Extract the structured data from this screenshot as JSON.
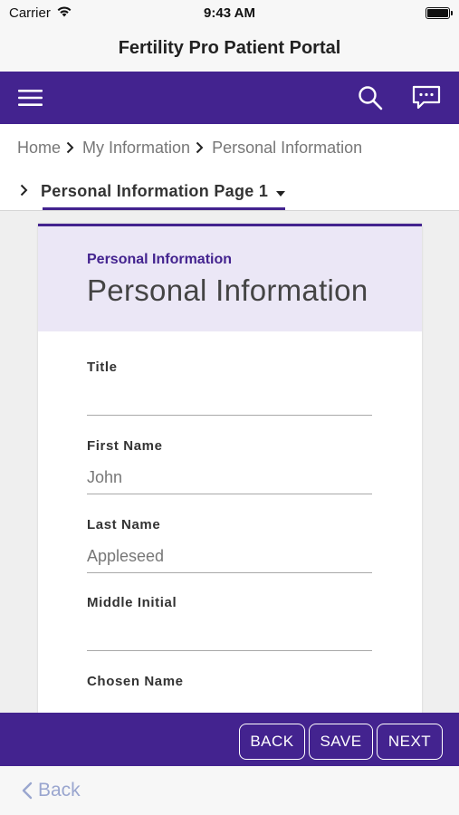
{
  "status_bar": {
    "carrier": "Carrier",
    "time": "9:43 AM"
  },
  "app": {
    "title": "Fertility Pro Patient Portal"
  },
  "nav": {
    "menu_icon": "hamburger-menu-icon",
    "search_icon": "search-icon",
    "messages_icon": "chat-bubble-icon"
  },
  "breadcrumb": {
    "items": [
      "Home",
      "My Information",
      "Personal Information"
    ]
  },
  "page_selector": {
    "label": "Personal Information Page 1"
  },
  "card": {
    "subtitle": "Personal Information",
    "title": "Personal Information"
  },
  "fields": {
    "title": {
      "label": "Title",
      "value": ""
    },
    "first_name": {
      "label": "First Name",
      "value": "John"
    },
    "last_name": {
      "label": "Last Name",
      "value": "Appleseed"
    },
    "middle_initial": {
      "label": "Middle Initial",
      "value": ""
    },
    "chosen_name": {
      "label": "Chosen Name",
      "value": ""
    }
  },
  "actions": {
    "back": "BACK",
    "save": "SAVE",
    "next": "NEXT"
  },
  "footer": {
    "back_label": "Back"
  },
  "colors": {
    "brand_purple": "#43238f",
    "card_header_bg": "#ebe7f6",
    "back_link": "#9aa6cf"
  }
}
